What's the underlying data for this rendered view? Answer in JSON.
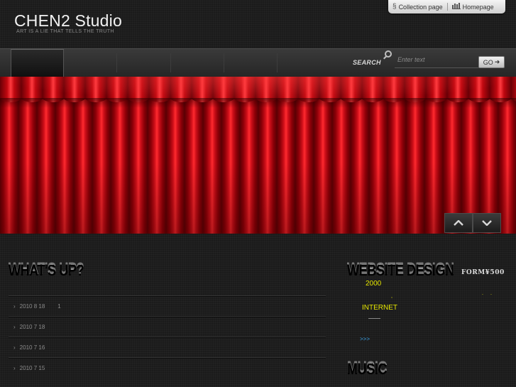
{
  "header": {
    "site_title": "CHEN2 Studio",
    "tagline": "ART IS A LIE THAT TELLS THE TRUTH",
    "top_links": [
      {
        "label": "Collection page",
        "icon": "link-icon"
      },
      {
        "label": "Homepage",
        "icon": "city-icon"
      }
    ]
  },
  "search": {
    "label": "SEARCH",
    "placeholder": "Enter text",
    "button_label": "GO"
  },
  "colors": {
    "curtain_red": "#d0101a",
    "accent_yellow": "#e6e600",
    "link_blue": "#3aa0e6"
  },
  "banner": {
    "controls": [
      {
        "icon": "chevron-up-icon"
      },
      {
        "icon": "chevron-down-icon"
      }
    ]
  },
  "whats_up": {
    "heading": "WHAT'S UP?",
    "items": [
      {
        "date": "2010 8 18",
        "title": "1"
      },
      {
        "date": "2010 7 18",
        "title": ""
      },
      {
        "date": "2010 7 16",
        "title": ""
      },
      {
        "date": "2010 7 15",
        "title": ""
      }
    ]
  },
  "website_design": {
    "heading": "WEBSITE DESIGN",
    "price_tag": "FORM¥500",
    "price": "2000",
    "dot_a": ",",
    "dot_b": ".",
    "dot_c": ".",
    "internet": "INTERNET",
    "more_link": ">>>"
  },
  "music": {
    "heading": "MUSIC"
  }
}
